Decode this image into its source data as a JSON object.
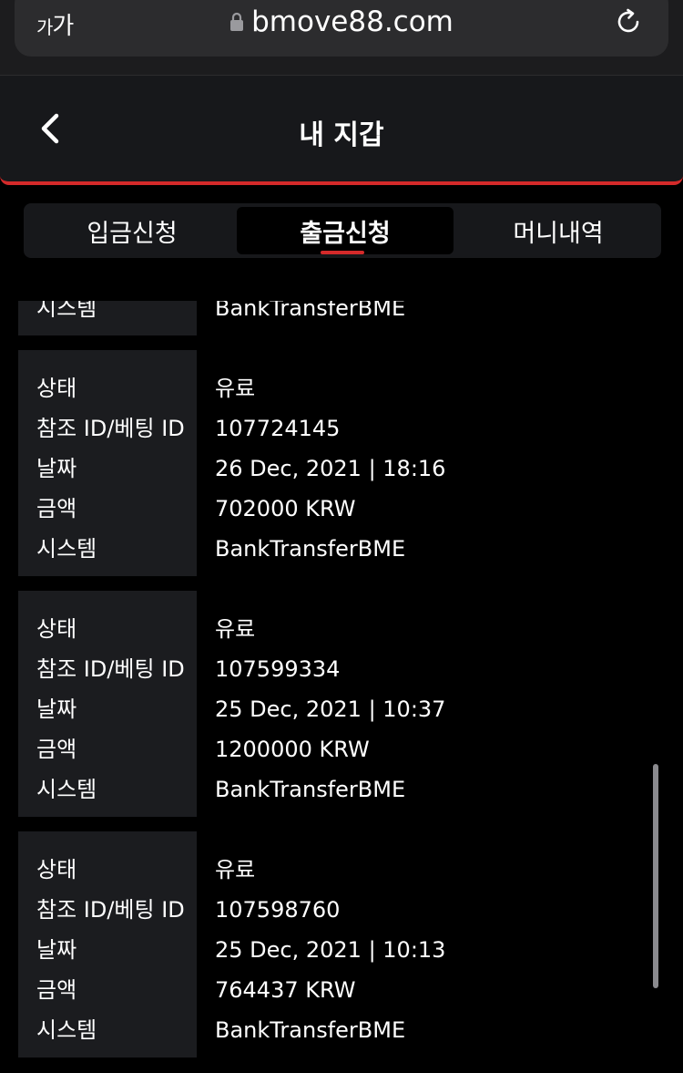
{
  "browser": {
    "aa_big": "가",
    "aa_small": "가",
    "url": "bmove88.com"
  },
  "header": {
    "title": "내 지갑"
  },
  "tabs": [
    {
      "label": "입금신청"
    },
    {
      "label": "출금신청"
    },
    {
      "label": "머니내역"
    }
  ],
  "labels": {
    "status": "상태",
    "ref": "참조 ID/베팅 ID",
    "date": "날짜",
    "amount": "금액",
    "system": "시스템"
  },
  "partial": {
    "label": "시스템",
    "value": "BankTransferBME"
  },
  "records": [
    {
      "status": "유료",
      "ref": "107724145",
      "date": "26 Dec, 2021 | 18:16",
      "amount": "702000 KRW",
      "system": "BankTransferBME"
    },
    {
      "status": "유료",
      "ref": "107599334",
      "date": "25 Dec, 2021 | 10:37",
      "amount": "1200000 KRW",
      "system": "BankTransferBME"
    },
    {
      "status": "유료",
      "ref": "107598760",
      "date": "25 Dec, 2021 | 10:13",
      "amount": "764437 KRW",
      "system": "BankTransferBME"
    }
  ],
  "colors": {
    "accent": "#d42a2a",
    "background": "#000000",
    "panel": "#17181b"
  }
}
